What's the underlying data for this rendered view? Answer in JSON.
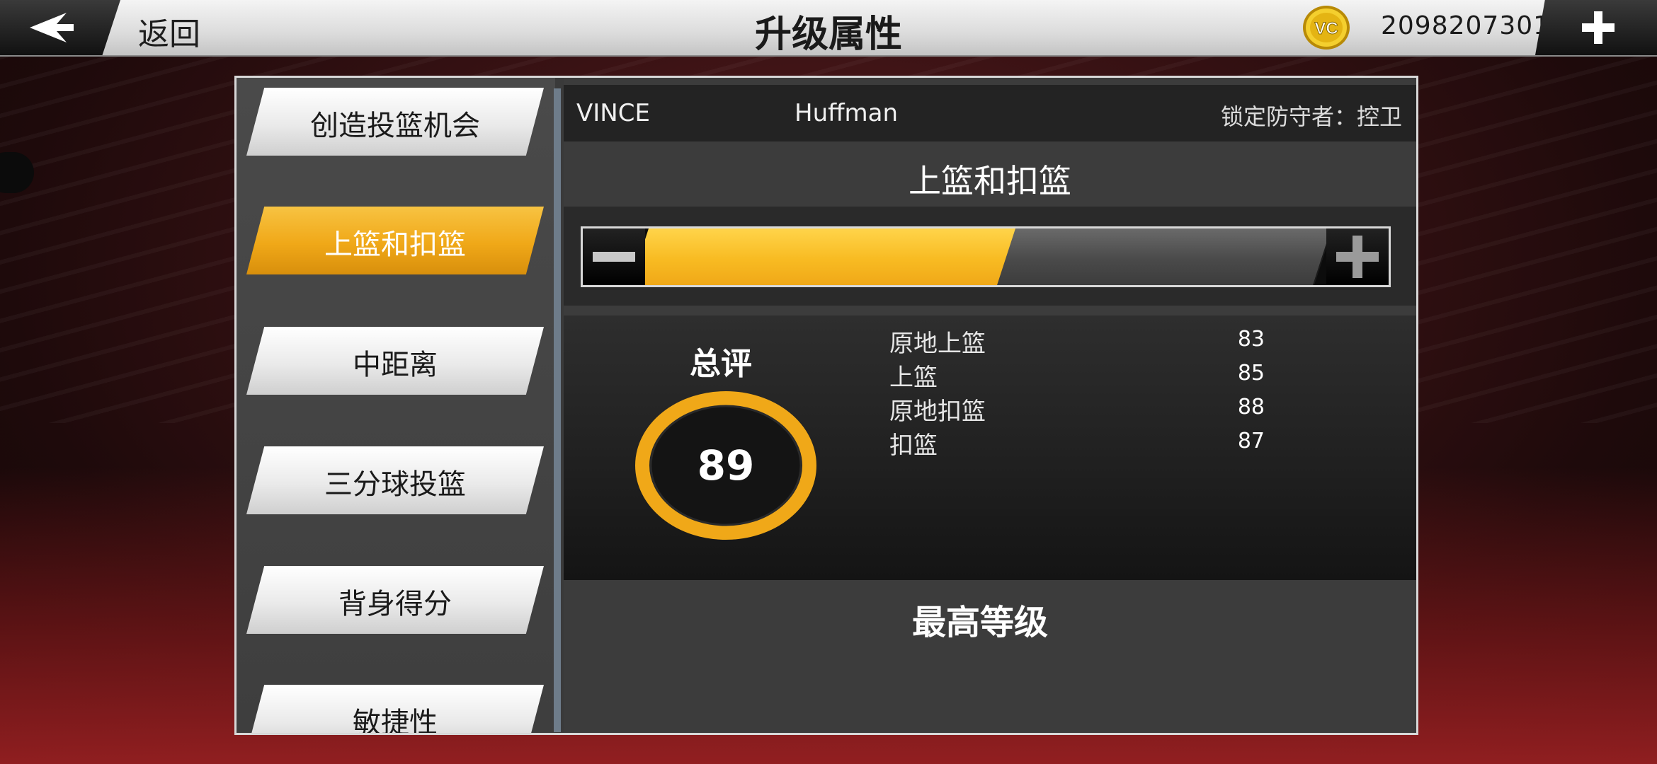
{
  "topbar": {
    "back_label": "返回",
    "title": "升级属性",
    "currency_icon": "vc-coin-icon",
    "currency_label": "VC",
    "balance": "2098207301"
  },
  "sidebar": {
    "items": [
      {
        "label": "创造投篮机会",
        "active": false
      },
      {
        "label": "上篮和扣篮",
        "active": true
      },
      {
        "label": "中距离",
        "active": false
      },
      {
        "label": "三分球投篮",
        "active": false
      },
      {
        "label": "背身得分",
        "active": false
      },
      {
        "label": "敏捷性",
        "active": false
      }
    ]
  },
  "player": {
    "first_name": "VINCE",
    "last_name": "Huffman",
    "lock_defender": "锁定防守者：控卫"
  },
  "category": {
    "title": "上篮和扣篮",
    "progress_filled": 14,
    "progress_total": 26
  },
  "overall": {
    "label": "总评",
    "value": "89",
    "ring_fraction": 0.96
  },
  "stats": [
    {
      "name": "原地上篮",
      "value": "83"
    },
    {
      "name": "上篮",
      "value": "85"
    },
    {
      "name": "原地扣篮",
      "value": "88"
    },
    {
      "name": "扣篮",
      "value": "87"
    }
  ],
  "footer": {
    "max_level": "最高等级"
  },
  "colors": {
    "accent": "#f0a818",
    "bar_empty": "#4a4a4a"
  }
}
